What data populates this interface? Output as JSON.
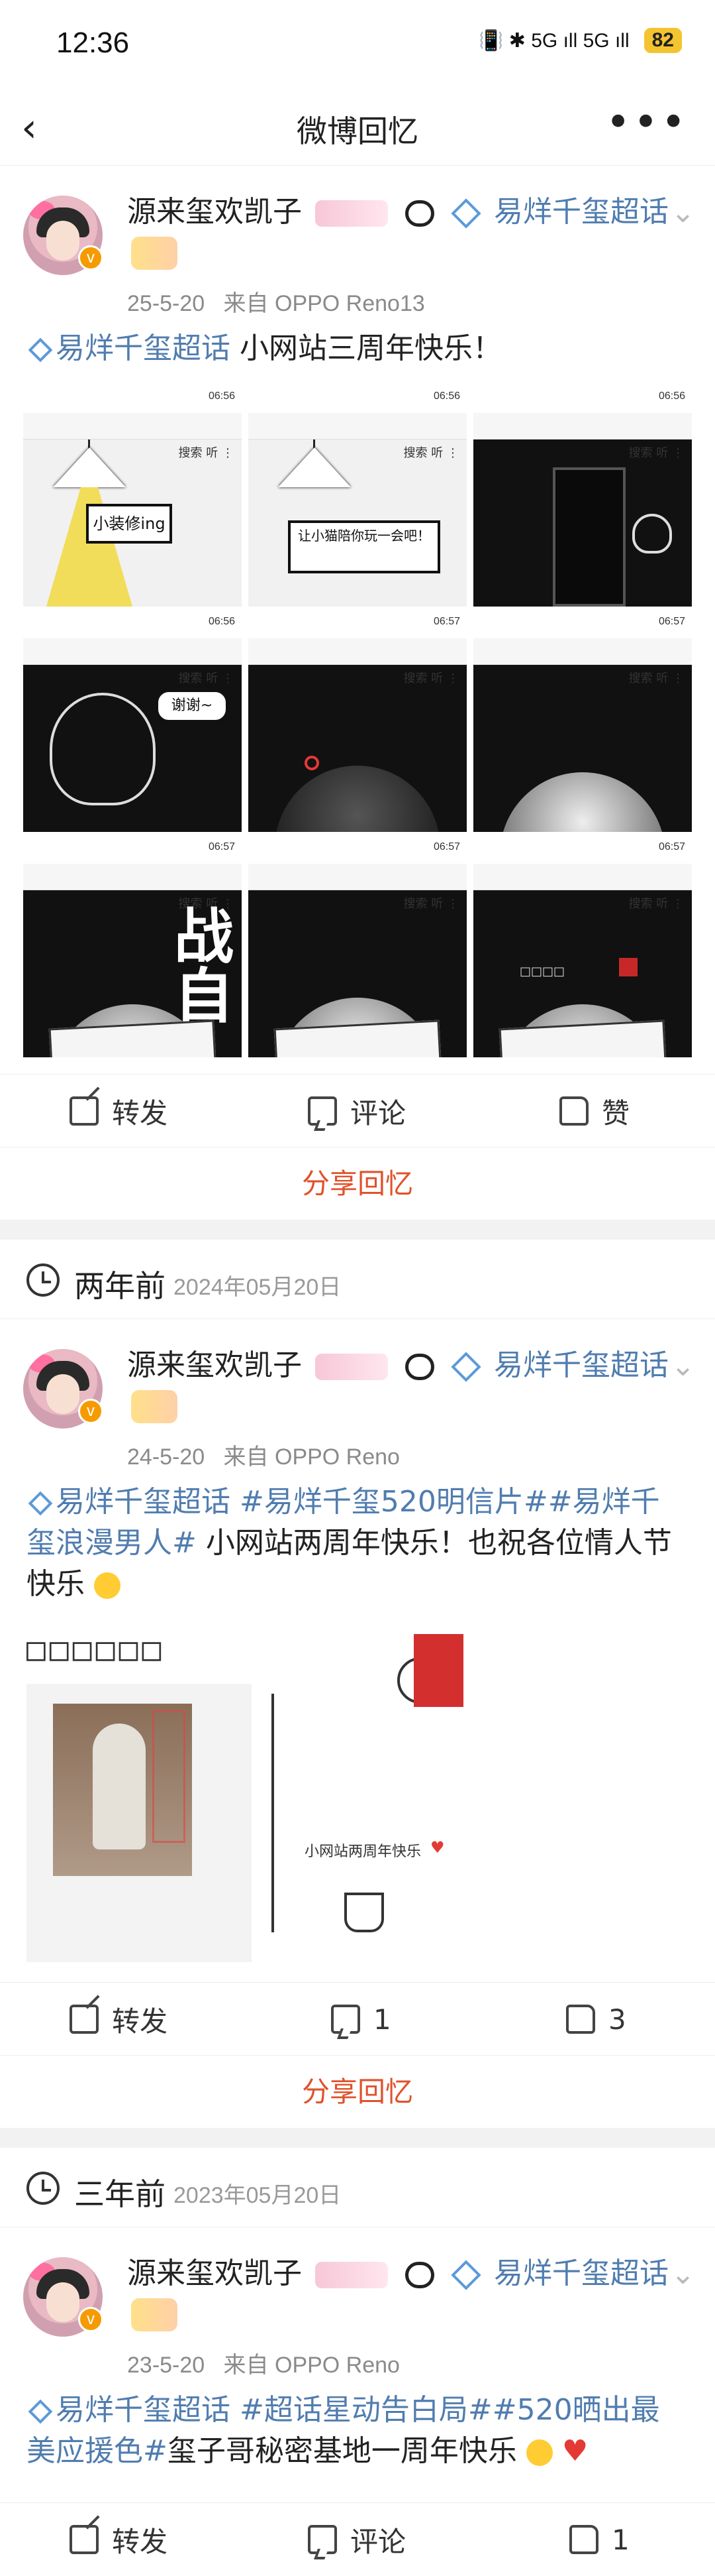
{
  "status_bar": {
    "time": "12:36",
    "icons": "📳 ✱ 5G ıll 5G ıll",
    "battery": "82"
  },
  "header": {
    "title": "微博回忆",
    "back_icon": "chevron-left-icon",
    "more_icon": "more-dots-icon"
  },
  "posts": [
    {
      "author": "源来玺欢凯子",
      "super_topic": "易烊千玺超话",
      "date": "25-5-20",
      "source": "来自 OPPO Reno13",
      "text_tag": "易烊千玺超话",
      "text": " 小网站三周年快乐！",
      "images": [
        {
          "tb": "06:56",
          "bar": "搜索  听  ⋮",
          "caption": "小装修ing"
        },
        {
          "tb": "06:56",
          "bar": "搜索  听  ⋮",
          "caption": "让小猫陪你玩一会吧！"
        },
        {
          "tb": "06:56",
          "bar": "搜索  听  ⋮",
          "caption": ""
        },
        {
          "tb": "06:56",
          "bar": "搜索  听  ⋮",
          "caption": "谢谢~"
        },
        {
          "tb": "06:57",
          "bar": "搜索  听  ⋮",
          "caption": ""
        },
        {
          "tb": "06:57",
          "bar": "搜索  听  ⋮",
          "caption": ""
        },
        {
          "tb": "06:57",
          "bar": "搜索  听  ⋮",
          "caption": "战自"
        },
        {
          "tb": "06:57",
          "bar": "搜索  听  ⋮",
          "caption": ""
        },
        {
          "tb": "06:57",
          "bar": "搜索  听  ⋮",
          "caption": "□□□□"
        }
      ],
      "actions": {
        "repost": "转发",
        "comment": "评论",
        "like": "赞"
      },
      "share": "分享回忆"
    },
    {
      "section_title": "两年前",
      "section_date": "2024年05月20日",
      "author": "源来玺欢凯子",
      "super_topic": "易烊千玺超话",
      "date": "24-5-20",
      "source": "来自 OPPO Reno",
      "text_tag": "易烊千玺超话 #易烊千玺520明信片##易烊千玺浪漫男人#",
      "text": " 小网站两周年快乐！也祝各位情人节快乐",
      "tofu": "□□□□□□",
      "postcard_text": "小网站两周年快乐",
      "actions": {
        "repost": "转发",
        "comment": "1",
        "like": "3"
      },
      "share": "分享回忆"
    },
    {
      "section_title": "三年前",
      "section_date": "2023年05月20日",
      "author": "源来玺欢凯子",
      "super_topic": "易烊千玺超话",
      "date": "23-5-20",
      "source": "来自 OPPO Reno",
      "text_tag": "易烊千玺超话 #超话星动告白局##520晒出最美应援色#",
      "text": "玺子哥秘密基地一周年快乐",
      "actions": {
        "repost": "转发",
        "comment": "评论",
        "like": "1"
      }
    }
  ],
  "colors": {
    "link": "#507daf",
    "share": "#e0522c",
    "divider": "#f2f2f2"
  }
}
